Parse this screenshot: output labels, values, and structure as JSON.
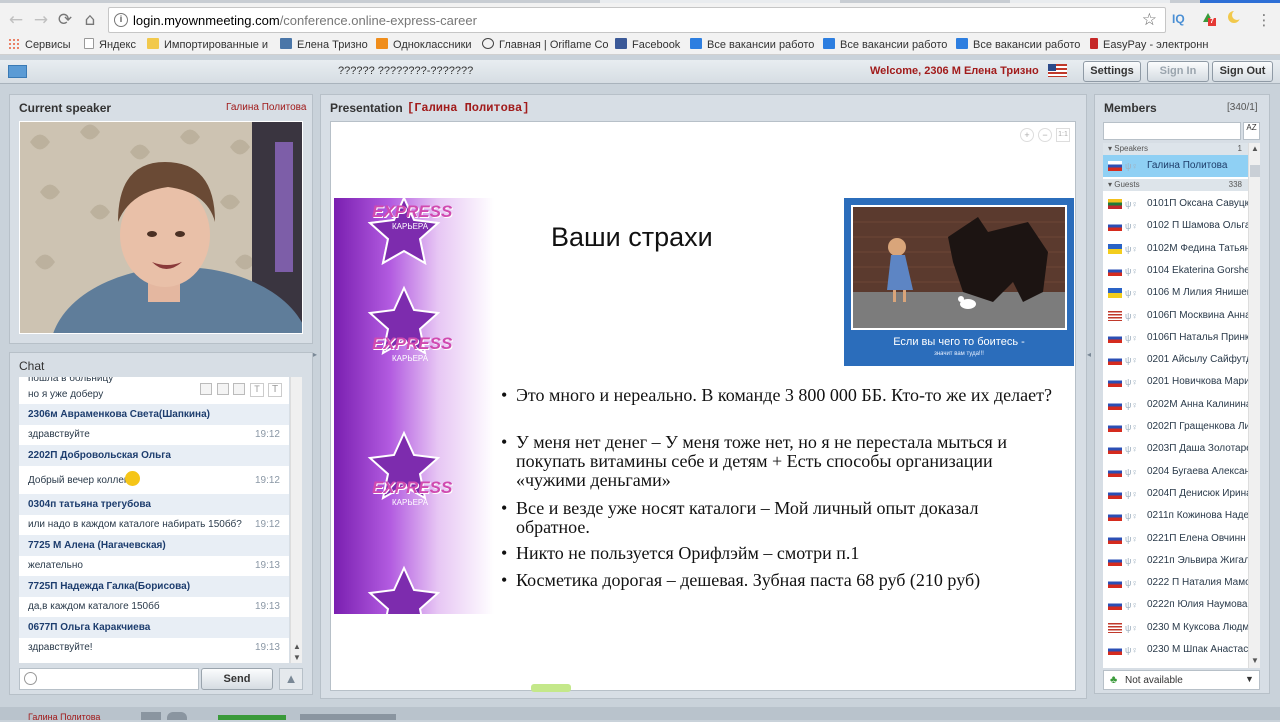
{
  "browser": {
    "url_host": "login.myownmeeting.com",
    "url_path": "/conference.online-express-career",
    "extensions": [
      {
        "icon": "iq-extension-icon",
        "text": "IQ",
        "color": "#4a8fd4"
      },
      {
        "icon": "badge-extension-icon",
        "text": "7",
        "color": "#e53935"
      },
      {
        "icon": "moon-extension-icon",
        "text": "",
        "color": "#f2c94c"
      }
    ],
    "bookmarks": [
      {
        "label": "Сервисы",
        "icon": "apps-grid-icon",
        "color": "#e85d3a"
      },
      {
        "label": "Яндекс",
        "icon": "page-icon",
        "color": "#dddddd"
      },
      {
        "label": "Импортированные и",
        "icon": "folder-icon",
        "color": "#f2c94c"
      },
      {
        "label": "Елена Тризно",
        "icon": "vk-icon",
        "color": "#4a76a8"
      },
      {
        "label": "Одноклассники",
        "icon": "odnoklassniki-icon",
        "color": "#f08d1a"
      },
      {
        "label": "Главная | Oriflame Co",
        "icon": "oriflame-icon",
        "color": "#444444"
      },
      {
        "label": "Facebook",
        "icon": "facebook-icon",
        "color": "#3b5998"
      },
      {
        "label": "Все вакансии работо",
        "icon": "folder-blue-icon",
        "color": "#2d7ee0"
      },
      {
        "label": "Все вакансии работо",
        "icon": "folder-blue-icon",
        "color": "#2d7ee0"
      },
      {
        "label": "Все вакансии работо",
        "icon": "folder-blue-icon",
        "color": "#2d7ee0"
      },
      {
        "label": "EasyPay - электронн",
        "icon": "easypay-icon",
        "color": "#c62828"
      }
    ]
  },
  "header": {
    "conference_title": "?????? ????????-???????",
    "welcome": "Welcome, 2306 M Елена Тризно",
    "settings_label": "Settings",
    "signin_label": "Sign In",
    "signout_label": "Sign Out"
  },
  "speaker": {
    "title": "Current speaker",
    "name": "Галина Политова"
  },
  "chat": {
    "title": "Chat",
    "send_label": "Send",
    "messages": [
      {
        "text": "пошла в больницу",
        "time": "",
        "who": ""
      },
      {
        "text": "но я уже доберу",
        "time": "",
        "who": ""
      },
      {
        "who": "2306м Авраменкова Света(Шапкина)",
        "text": "здравствуйте",
        "time": "19:12"
      },
      {
        "who": "2202П Добровольская Ольга",
        "text": "Добрый вечер коллеги",
        "time": "19:12"
      },
      {
        "who": "0304п татьяна трегубова",
        "text": "или надо в каждом каталоге набирать 150бб?",
        "time": "19:12"
      },
      {
        "who": "7725 М Алена (Нагачевская)",
        "text": "желательно",
        "time": "19:13"
      },
      {
        "who": "7725П Надежда Галка(Борисова)",
        "text": "да,в каждом каталоге 150бб",
        "time": "19:13"
      },
      {
        "who": "0677П Ольга Каракчиева",
        "text": "здравствуйте!",
        "time": "19:13"
      }
    ]
  },
  "presentation": {
    "title": "Presentation",
    "presenter": "[Галина Политова]",
    "slide_title": "Ваши страхи",
    "brand_top": "EXPRESS",
    "brand_bottom": "КАРЬЕРА",
    "caption_main": "Если вы чего то боитесь -",
    "caption_sub": "значит вам туда!!!",
    "bullets": [
      "Это много и нереально. В команде 3 800 000 ББ. Кто-то же их делает?",
      "У меня нет денег – У меня тоже нет, но я не перестала мыться и покупать витамины себе и детям + Есть способы организации «чужими деньгами»",
      "Все и везде уже носят каталоги – Мой личный опыт доказал обратное.",
      "Никто не пользуется Орифлэйм – смотри п.1",
      "Косметика дорогая – дешевая. Зубная паста 68 руб (210 руб)"
    ]
  },
  "members": {
    "title": "Members",
    "count": "[340/1]",
    "speakers_label": "Speakers",
    "speakers_count": "1",
    "guests_label": "Guests",
    "guests_count": "338",
    "status_label": "Not available",
    "speaker": {
      "name": "Галина Политова",
      "flag": "ru"
    },
    "guests": [
      {
        "name": "0101П Оксана Савуцк",
        "flag": "lt"
      },
      {
        "name": "0102 П Шамова Ольга",
        "flag": "ru"
      },
      {
        "name": "0102М Федина Татьян",
        "flag": "ua"
      },
      {
        "name": "0104 Ekaterina Gorsher",
        "flag": "ru"
      },
      {
        "name": "0106 М Лилия Янишев",
        "flag": "ua"
      },
      {
        "name": "0106П Москвина Анна",
        "flag": "us"
      },
      {
        "name": "0106П Наталья Принк",
        "flag": "ru"
      },
      {
        "name": "0201 Айсылу Сайфутд",
        "flag": "ru"
      },
      {
        "name": "0201 Новичкова Мари",
        "flag": "ru"
      },
      {
        "name": "0202М Анна Калинина",
        "flag": "ru"
      },
      {
        "name": "0202П Гращенкова Ли",
        "flag": "ru"
      },
      {
        "name": "0203П Даша Золотаре",
        "flag": "ru"
      },
      {
        "name": "0204 Бугаева Алексан",
        "flag": "ru"
      },
      {
        "name": "0204П Денисюк Ирина",
        "flag": "ru"
      },
      {
        "name": "0211п Кожинова Наде",
        "flag": "ru"
      },
      {
        "name": "0221П Елена Овчинн",
        "flag": "ru"
      },
      {
        "name": "0221п Эльвира Жигал",
        "flag": "ru"
      },
      {
        "name": "0222 П Наталия Мамо",
        "flag": "ru"
      },
      {
        "name": "0222п Юлия Наумова",
        "flag": "ru"
      },
      {
        "name": "0230 М Куксова Людм",
        "flag": "us"
      },
      {
        "name": "0230 М Шпак Анастас",
        "flag": "ru"
      }
    ]
  },
  "footer": {
    "speaker_name": "Галина Политова"
  },
  "colors": {
    "accent_red": "#a11b1b",
    "panel_bg": "#d7dee5",
    "slide_purple": "#8a2bd0"
  }
}
